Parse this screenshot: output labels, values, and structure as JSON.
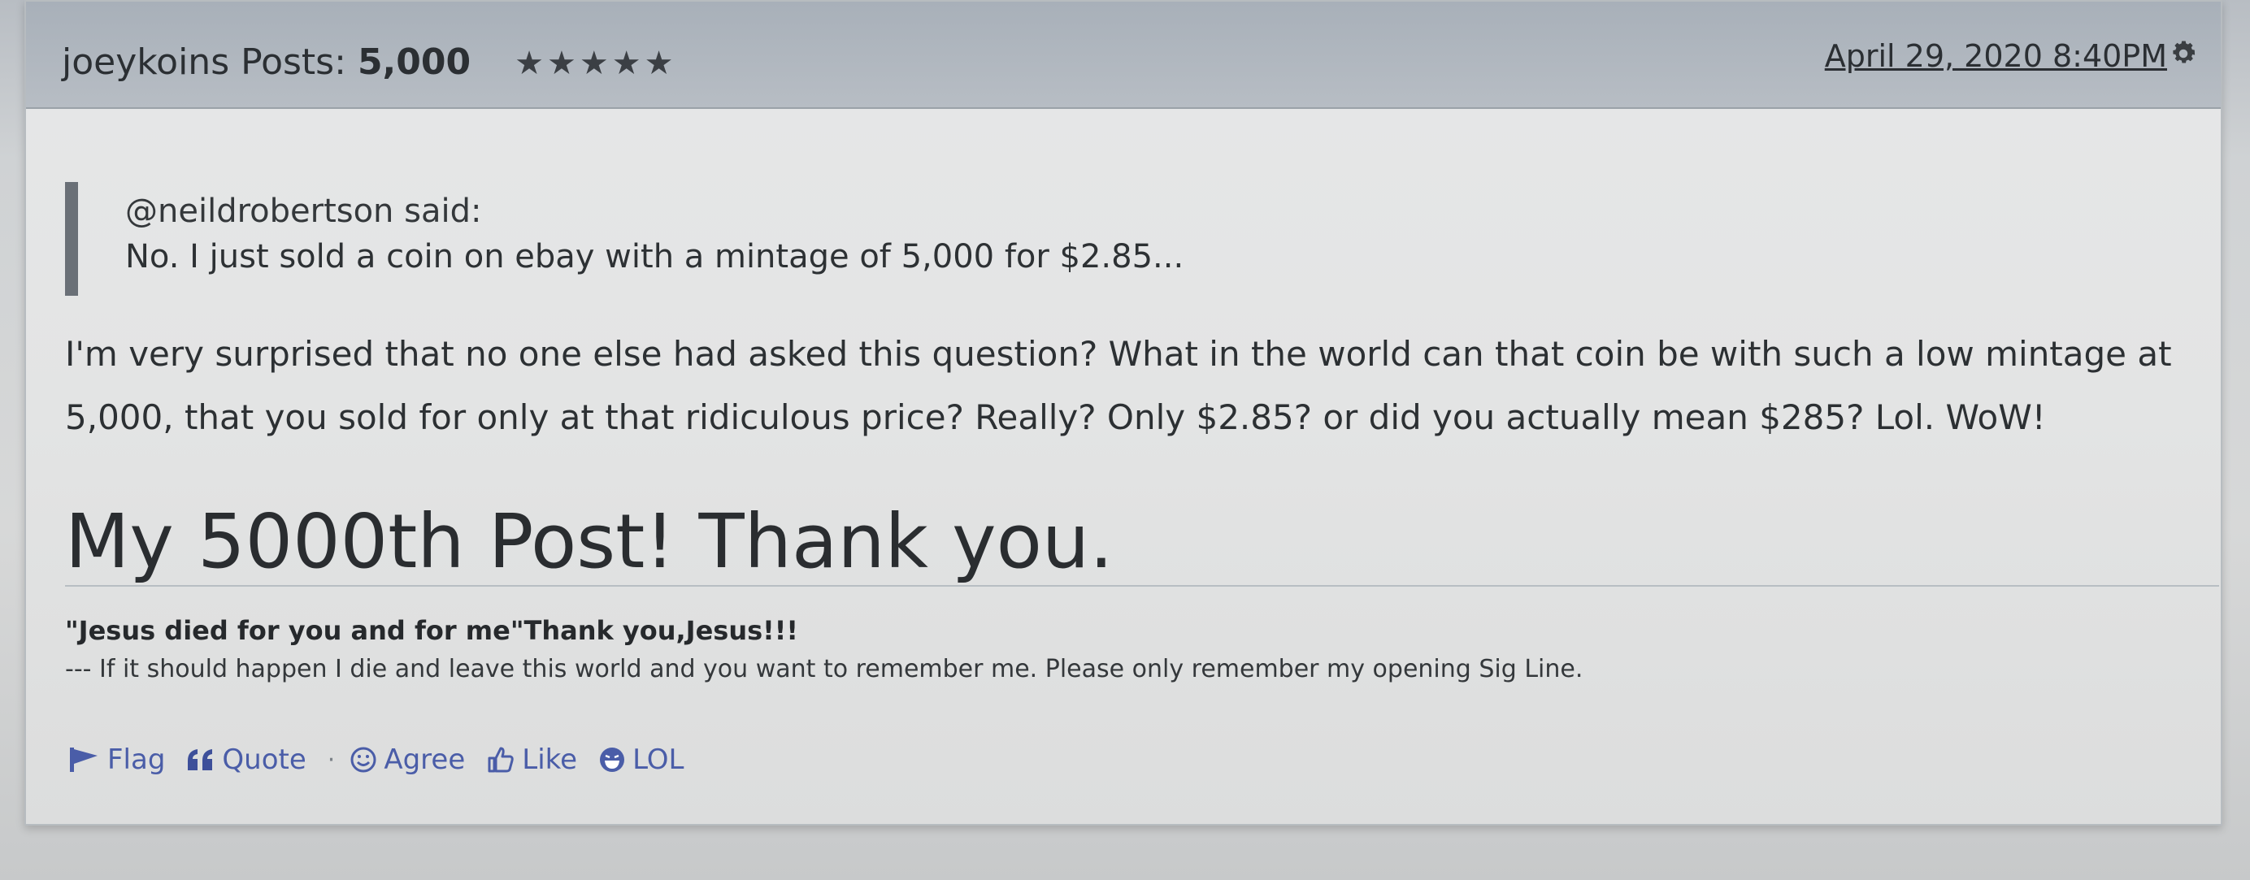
{
  "post": {
    "author": "joeykoins",
    "posts_label": "Posts:",
    "posts_count": "5,000",
    "stars": "★★★★★",
    "date": "April 29, 2020 8:40PM"
  },
  "quote": {
    "author_line": "@neildrobertson said:",
    "text": "No. I just sold a coin on ebay with a mintage of 5,000 for $2.85..."
  },
  "body": {
    "paragraph": "I'm very surprised that no one else had asked this question? What in the world can that coin be with such a low mintage at 5,000, that you sold for only at that ridiculous price? Really? Only $2.85? or did you actually mean $285? Lol. WoW!",
    "headline": "My 5000th Post! Thank you."
  },
  "signature": {
    "line1": "\"Jesus died for you and for me\"Thank you,Jesus!!!",
    "line2": "--- If it should happen I die and leave this world and you want to remember me. Please only remember my opening Sig Line."
  },
  "actions": {
    "flag": "Flag",
    "quote": "Quote",
    "separator": "·",
    "agree": "Agree",
    "like": "Like",
    "lol": "LOL"
  },
  "icons": {
    "flag": "flag-icon",
    "quote": "quote-icon",
    "agree": "smile-icon",
    "like": "thumbs-up-icon",
    "lol": "laugh-icon",
    "options": "gear-icon"
  },
  "colors": {
    "link": "#4a5da8",
    "header_bg": "#b0b7be",
    "quote_bar": "#6a7077"
  }
}
